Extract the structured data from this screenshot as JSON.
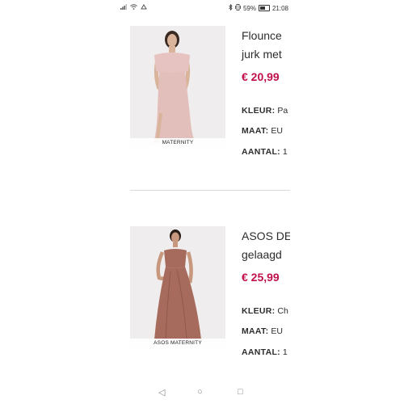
{
  "status_bar": {
    "left_icons": [
      "signal-icon",
      "wifi-icon",
      "notification-icon"
    ],
    "battery_percent": "59%",
    "time": "21:08"
  },
  "products": [
    {
      "image_caption": "MATERNITY",
      "title_line1": "Flounce",
      "title_line2": "jurk met",
      "price": "€ 20,99",
      "color_label": "KLEUR:",
      "color_value": "Pa",
      "size_label": "MAAT:",
      "size_value": "EU",
      "qty_label": "AANTAL:",
      "qty_value": "1"
    },
    {
      "image_caption": "ASOS MATERNITY",
      "title_line1": "ASOS DE",
      "title_line2": "gelaagd",
      "price": "€ 25,99",
      "color_label": "KLEUR:",
      "color_value": "Ch",
      "size_label": "MAAT:",
      "size_value": "EU",
      "qty_label": "AANTAL:",
      "qty_value": "1"
    }
  ],
  "nav": {
    "back": "◁",
    "home": "○",
    "recent": "□"
  },
  "colors": {
    "price": "#c0104c",
    "dress1": "#e6c3c0",
    "dress2": "#a66b5c"
  }
}
